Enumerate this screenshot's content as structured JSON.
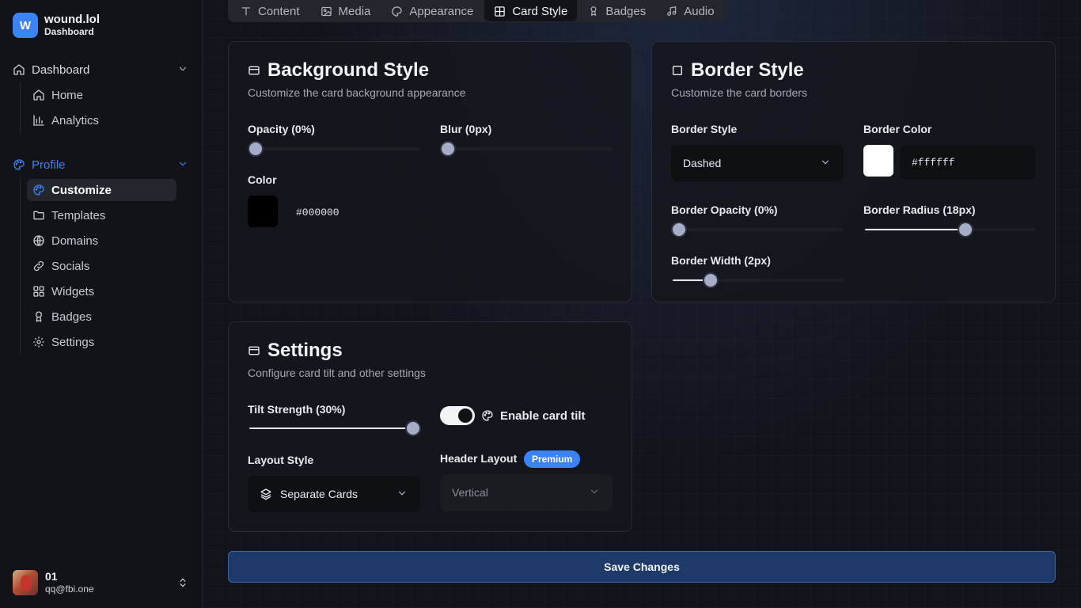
{
  "brand": {
    "logo_letter": "W",
    "name": "wound.lol",
    "subtitle": "Dashboard",
    "accent": "#3b82f6"
  },
  "sidebar": {
    "groups": [
      {
        "label": "Dashboard",
        "items": [
          {
            "label": "Home",
            "icon": "home-icon"
          },
          {
            "label": "Analytics",
            "icon": "bar-chart-icon"
          }
        ]
      },
      {
        "label": "Profile",
        "items": [
          {
            "label": "Customize",
            "icon": "palette-icon",
            "active": true
          },
          {
            "label": "Templates",
            "icon": "folder-icon"
          },
          {
            "label": "Domains",
            "icon": "globe-icon"
          },
          {
            "label": "Socials",
            "icon": "link-icon"
          },
          {
            "label": "Widgets",
            "icon": "grid-icon"
          },
          {
            "label": "Badges",
            "icon": "award-icon"
          },
          {
            "label": "Settings",
            "icon": "gear-icon"
          }
        ]
      }
    ]
  },
  "user": {
    "name": "01",
    "email": "qq@fbi.one"
  },
  "tabs": [
    {
      "label": "Content",
      "icon": "text-icon"
    },
    {
      "label": "Media",
      "icon": "image-icon"
    },
    {
      "label": "Appearance",
      "icon": "palette-icon"
    },
    {
      "label": "Card Style",
      "icon": "table-icon",
      "active": true
    },
    {
      "label": "Badges",
      "icon": "award-icon"
    },
    {
      "label": "Audio",
      "icon": "music-icon"
    }
  ],
  "background_card": {
    "title": "Background Style",
    "description": "Customize the card background appearance",
    "opacity_label": "Opacity (0%)",
    "opacity_value": 0,
    "blur_label": "Blur (0px)",
    "blur_value": 0,
    "color_label": "Color",
    "color_hex": "#000000"
  },
  "border_card": {
    "title": "Border Style",
    "description": "Customize the card borders",
    "style_label": "Border Style",
    "style_value": "Dashed",
    "color_label": "Border Color",
    "color_hex": "#ffffff",
    "opacity_label": "Border Opacity (0%)",
    "opacity_value": 0,
    "radius_label": "Border Radius (18px)",
    "radius_fraction": 0.6,
    "width_label": "Border Width (2px)",
    "width_fraction": 0.2
  },
  "settings_card": {
    "title": "Settings",
    "description": "Configure card tilt and other settings",
    "tilt_label": "Tilt Strength (30%)",
    "tilt_fraction": 1.0,
    "tilt_toggle_label": "Enable card tilt",
    "tilt_enabled": true,
    "layout_label": "Layout Style",
    "layout_value": "Separate Cards",
    "header_label": "Header Layout",
    "header_badge": "Premium",
    "header_value": "Vertical"
  },
  "save_label": "Save Changes"
}
